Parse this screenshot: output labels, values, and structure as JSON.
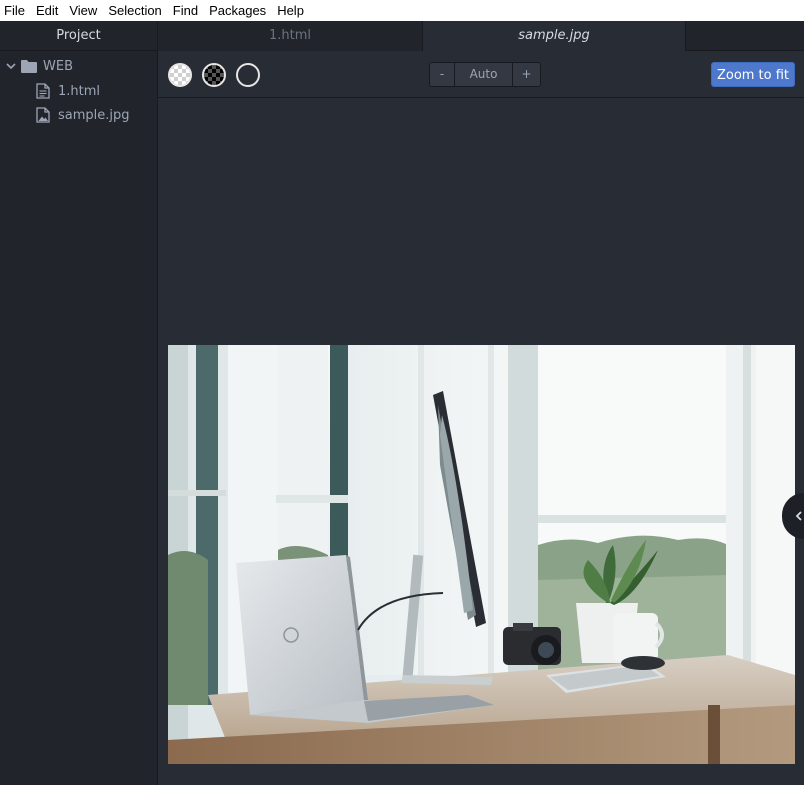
{
  "menubar": {
    "items": [
      "File",
      "Edit",
      "View",
      "Selection",
      "Find",
      "Packages",
      "Help"
    ]
  },
  "sidebar": {
    "title": "Project",
    "folder": {
      "name": "WEB",
      "icon": "folder-icon",
      "expanded": true
    },
    "files": [
      {
        "name": "1.html",
        "icon": "file-text-icon"
      },
      {
        "name": "sample.jpg",
        "icon": "file-image-icon"
      }
    ]
  },
  "tabs": [
    {
      "label": "1.html",
      "active": false
    },
    {
      "label": "sample.jpg",
      "active": true
    }
  ],
  "image_view": {
    "zoom_minus": "-",
    "zoom_value": "Auto",
    "zoom_plus": "+",
    "zoom_fit": "Zoom to fit",
    "background_options": [
      "light-checker",
      "dark-checker",
      "transparent"
    ]
  },
  "colors": {
    "accent": "#4d78cc",
    "panel": "#21252b",
    "editor": "#282c34"
  }
}
